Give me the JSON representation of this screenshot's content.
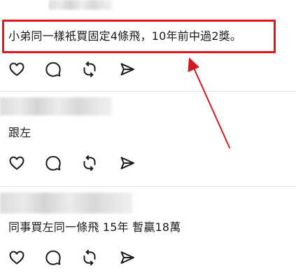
{
  "comments": [
    {
      "text": "小弟同一樣衹買固定4條飛，10年前中過2獎。"
    },
    {
      "text": "跟左"
    },
    {
      "text": "同事買左同一條飛 15年 暫贏18萬"
    }
  ],
  "annotation": {
    "box_color": "#e1161c",
    "arrow_color": "#d11a20"
  },
  "icons": {
    "like": "heart-icon",
    "reply": "comment-bubble-icon",
    "repost": "repost-icon",
    "share": "share-send-icon"
  }
}
